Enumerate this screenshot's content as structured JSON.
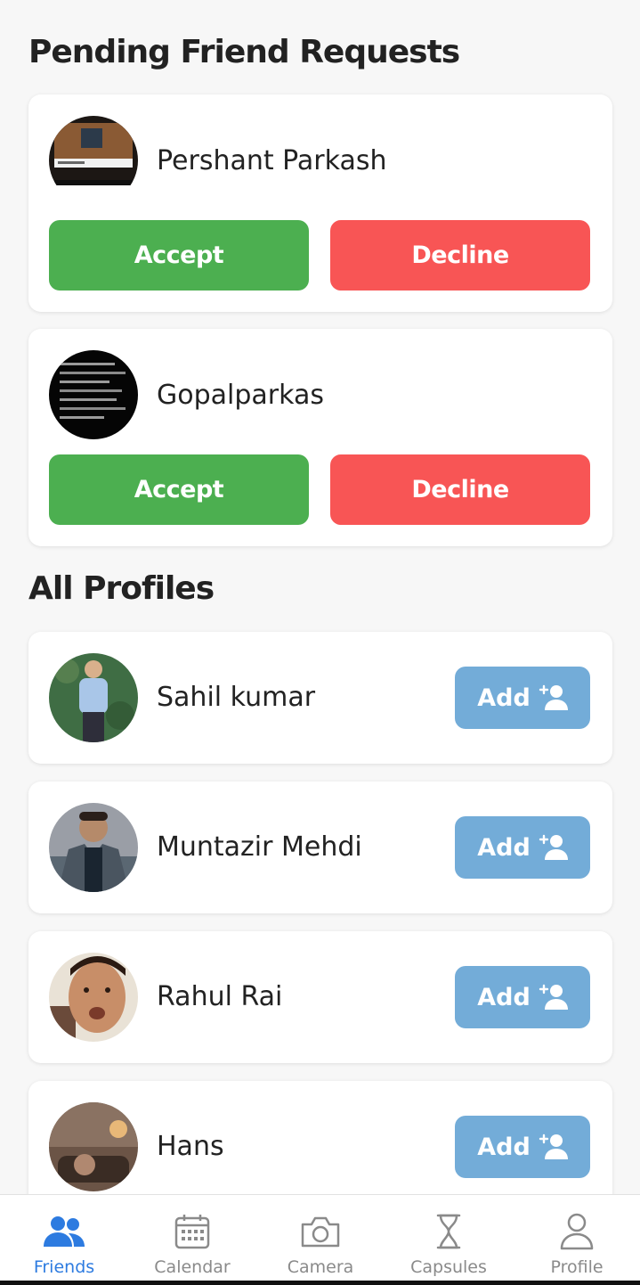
{
  "pending": {
    "title": "Pending Friend Requests",
    "requests": [
      {
        "name": "Pershant Parkash",
        "accept_label": "Accept",
        "decline_label": "Decline"
      },
      {
        "name": "Gopalparkas",
        "accept_label": "Accept",
        "decline_label": "Decline"
      }
    ]
  },
  "profiles": {
    "title": "All Profiles",
    "items": [
      {
        "name": "Sahil kumar",
        "add_label": "Add",
        "add_icon": "add-user-icon"
      },
      {
        "name": "Muntazir Mehdi",
        "add_label": "Add",
        "add_icon": "add-user-icon"
      },
      {
        "name": "Rahul Rai",
        "add_label": "Add",
        "add_icon": "add-user-icon"
      },
      {
        "name": "Hans",
        "add_label": "Add",
        "add_icon": "add-user-icon"
      }
    ]
  },
  "tabs": [
    {
      "label": "Friends",
      "icon": "friends-icon",
      "active": true
    },
    {
      "label": "Calendar",
      "icon": "calendar-icon",
      "active": false
    },
    {
      "label": "Camera",
      "icon": "camera-icon",
      "active": false
    },
    {
      "label": "Capsules",
      "icon": "hourglass-icon",
      "active": false
    },
    {
      "label": "Profile",
      "icon": "profile-icon",
      "active": false
    }
  ],
  "colors": {
    "accept": "#4caf50",
    "decline": "#f85555",
    "add": "#73acd8",
    "active_tab": "#2d7be0",
    "inactive_tab": "#8a8a8a"
  }
}
